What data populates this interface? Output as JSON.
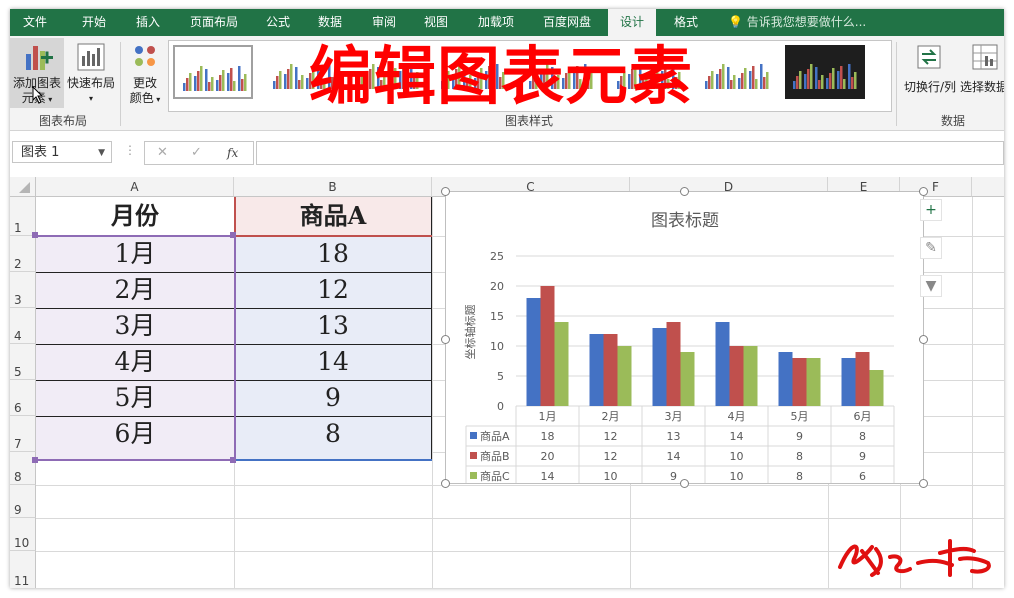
{
  "tabs": [
    "文件",
    "开始",
    "插入",
    "页面布局",
    "公式",
    "数据",
    "审阅",
    "视图",
    "加载项",
    "百度网盘",
    "设计",
    "格式"
  ],
  "active_tab": "设计",
  "tell_me": "告诉我您想要做什么...",
  "ribbon": {
    "add_element_l1": "添加图表",
    "add_element_l2": "元素",
    "quick_layout_l1": "快速布局",
    "change_color_l1": "更改",
    "change_color_l2": "颜色",
    "group_layout": "图表布局",
    "group_styles": "图表样式",
    "switch_rowcol": "切换行/列",
    "select_data": "选择数据",
    "group_data": "数据"
  },
  "overlay_title": "编辑图表元素",
  "namebox": "图表 1",
  "formula_icons": {
    "cancel": "✕",
    "enter": "✓",
    "fx": "fx"
  },
  "columns": [
    "A",
    "B",
    "C",
    "D",
    "E",
    "F"
  ],
  "rows": [
    "1",
    "2",
    "3",
    "4",
    "5",
    "6",
    "7",
    "8",
    "9",
    "10",
    "11"
  ],
  "table": {
    "header_month": "月份",
    "header_a": "商品A",
    "months": [
      "1月",
      "2月",
      "3月",
      "4月",
      "5月",
      "6月"
    ],
    "values_a": [
      "18",
      "12",
      "13",
      "14",
      "9",
      "8"
    ]
  },
  "chart_data": {
    "type": "bar",
    "title": "图表标题",
    "xlabel": "",
    "ylabel": "坐标轴标题",
    "categories": [
      "1月",
      "2月",
      "3月",
      "4月",
      "5月",
      "6月"
    ],
    "ylim": [
      0,
      25
    ],
    "yticks": [
      "0",
      "5",
      "10",
      "15",
      "20",
      "25"
    ],
    "grid": true,
    "legend": "data-table",
    "series": [
      {
        "name": "商品A",
        "values": [
          18,
          12,
          13,
          14,
          9,
          8
        ],
        "color": "#4472c4"
      },
      {
        "name": "商品B",
        "values": [
          20,
          12,
          14,
          10,
          8,
          9
        ],
        "color": "#c0504d"
      },
      {
        "name": "商品C",
        "values": [
          14,
          10,
          9,
          10,
          8,
          6
        ],
        "color": "#9bbb59"
      }
    ]
  },
  "colors": {
    "excel_green": "#217346",
    "overlay_red": "#ff0000"
  }
}
